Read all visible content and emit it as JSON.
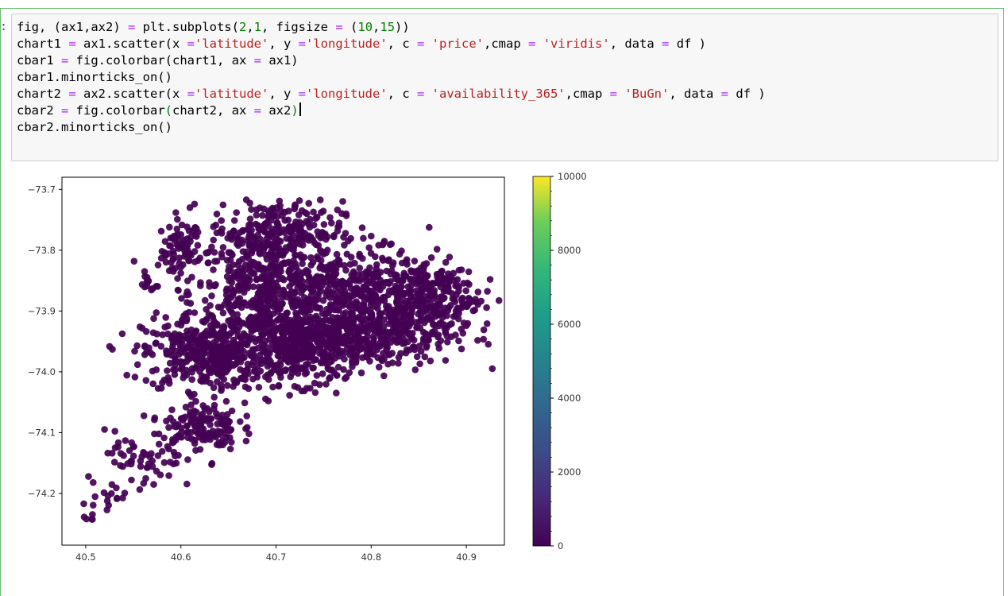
{
  "prompt": ":",
  "code_lines": [
    [
      [
        "t",
        "fig, (ax1,ax2) "
      ],
      [
        "op",
        "="
      ],
      [
        "t",
        " plt.subplots("
      ],
      [
        "num",
        "2"
      ],
      [
        "t",
        ","
      ],
      [
        "num",
        "1"
      ],
      [
        "t",
        ", figsize "
      ],
      [
        "op",
        "="
      ],
      [
        "t",
        " ("
      ],
      [
        "num",
        "10"
      ],
      [
        "t",
        ","
      ],
      [
        "num",
        "15"
      ],
      [
        "t",
        "))"
      ]
    ],
    [
      [
        "t",
        "chart1 "
      ],
      [
        "op",
        "="
      ],
      [
        "t",
        " ax1.scatter(x "
      ],
      [
        "op",
        "="
      ],
      [
        "str",
        "'latitude'"
      ],
      [
        "t",
        ", y "
      ],
      [
        "op",
        "="
      ],
      [
        "str",
        "'longitude'"
      ],
      [
        "t",
        ", c "
      ],
      [
        "op",
        "="
      ],
      [
        "t",
        " "
      ],
      [
        "str",
        "'price'"
      ],
      [
        "t",
        ",cmap "
      ],
      [
        "op",
        "="
      ],
      [
        "t",
        " "
      ],
      [
        "str",
        "'viridis'"
      ],
      [
        "t",
        ", data "
      ],
      [
        "op",
        "="
      ],
      [
        "t",
        " df )"
      ]
    ],
    [
      [
        "t",
        "cbar1 "
      ],
      [
        "op",
        "="
      ],
      [
        "t",
        " fig.colorbar(chart1, ax "
      ],
      [
        "op",
        "="
      ],
      [
        "t",
        " ax1)"
      ]
    ],
    [
      [
        "t",
        "cbar1.minorticks_on()"
      ]
    ],
    [
      [
        "t",
        "chart2 "
      ],
      [
        "op",
        "="
      ],
      [
        "t",
        " ax2.scatter(x "
      ],
      [
        "op",
        "="
      ],
      [
        "str",
        "'latitude'"
      ],
      [
        "t",
        ", y "
      ],
      [
        "op",
        "="
      ],
      [
        "str",
        "'longitude'"
      ],
      [
        "t",
        ", c "
      ],
      [
        "op",
        "="
      ],
      [
        "t",
        " "
      ],
      [
        "str",
        "'availability_365'"
      ],
      [
        "t",
        ",cmap "
      ],
      [
        "op",
        "="
      ],
      [
        "t",
        " "
      ],
      [
        "str",
        "'BuGn'"
      ],
      [
        "t",
        ", data "
      ],
      [
        "op",
        "="
      ],
      [
        "t",
        " df )"
      ]
    ],
    [
      [
        "t",
        "cbar2 "
      ],
      [
        "op",
        "="
      ],
      [
        "t",
        " fig.colorbar"
      ],
      [
        "num",
        "("
      ],
      [
        "t",
        "chart2, ax "
      ],
      [
        "op",
        "="
      ],
      [
        "t",
        " ax2"
      ],
      [
        "num",
        ")"
      ],
      [
        "cursor",
        ""
      ]
    ],
    [
      [
        "t",
        "cbar2.minorticks_on()"
      ]
    ]
  ],
  "chart_data": {
    "type": "scatter",
    "x_ticks": [
      "40.5",
      "40.6",
      "40.7",
      "40.8",
      "40.9"
    ],
    "x_tick_values": [
      40.5,
      40.6,
      40.7,
      40.8,
      40.9
    ],
    "y_ticks": [
      "−73.7",
      "−73.8",
      "−73.9",
      "−74.0",
      "−74.1",
      "−74.2"
    ],
    "y_tick_values": [
      -73.7,
      -73.8,
      -73.9,
      -74.0,
      -74.1,
      -74.2
    ],
    "xlim": [
      40.475,
      40.94
    ],
    "ylim": [
      -74.285,
      -73.68
    ],
    "colorbar": {
      "cmap": "viridis",
      "range": [
        0,
        10000
      ],
      "ticks": [
        "0",
        "2000",
        "4000",
        "6000",
        "8000",
        "10000"
      ],
      "tick_values": [
        0,
        2000,
        4000,
        6000,
        8000,
        10000
      ]
    },
    "point_color": "#440154",
    "clusters": [
      {
        "x": 40.6,
        "y": -73.8,
        "sx": 0.01,
        "sy": 0.025,
        "n": 70
      },
      {
        "x": 40.565,
        "y": -73.855,
        "sx": 0.005,
        "sy": 0.008,
        "n": 12
      },
      {
        "x": 40.69,
        "y": -73.87,
        "sx": 0.04,
        "sy": 0.045,
        "n": 520
      },
      {
        "x": 40.63,
        "y": -73.97,
        "sx": 0.035,
        "sy": 0.03,
        "n": 420
      },
      {
        "x": 40.73,
        "y": -73.96,
        "sx": 0.03,
        "sy": 0.03,
        "n": 380
      },
      {
        "x": 40.7,
        "y": -73.77,
        "sx": 0.035,
        "sy": 0.025,
        "n": 260
      },
      {
        "x": 40.8,
        "y": -73.93,
        "sx": 0.045,
        "sy": 0.03,
        "n": 420
      },
      {
        "x": 40.85,
        "y": -73.87,
        "sx": 0.03,
        "sy": 0.03,
        "n": 300
      },
      {
        "x": 40.78,
        "y": -73.85,
        "sx": 0.03,
        "sy": 0.02,
        "n": 160
      },
      {
        "x": 40.62,
        "y": -74.09,
        "sx": 0.02,
        "sy": 0.02,
        "n": 140
      },
      {
        "x": 40.56,
        "y": -74.15,
        "sx": 0.02,
        "sy": 0.025,
        "n": 60
      },
      {
        "x": 40.52,
        "y": -74.21,
        "sx": 0.012,
        "sy": 0.015,
        "n": 14
      },
      {
        "x": 40.505,
        "y": -74.24,
        "sx": 0.004,
        "sy": 0.004,
        "n": 5
      },
      {
        "x": 40.9,
        "y": -73.89,
        "sx": 0.006,
        "sy": 0.006,
        "n": 10
      },
      {
        "x": 40.815,
        "y": -73.79,
        "sx": 0.005,
        "sy": 0.004,
        "n": 6
      }
    ]
  }
}
